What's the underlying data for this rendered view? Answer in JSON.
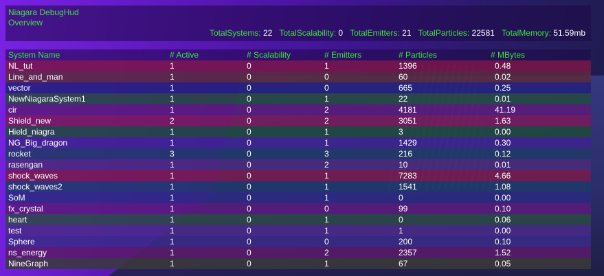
{
  "hud": {
    "title": "Niagara DebugHud",
    "subtitle": "Overview",
    "stats": [
      {
        "label": "TotalSystems:",
        "value": "22"
      },
      {
        "label": "TotalScalability:",
        "value": "0"
      },
      {
        "label": "TotalEmitters:",
        "value": "21"
      },
      {
        "label": "TotalParticles:",
        "value": "22581"
      },
      {
        "label": "TotalMemory:",
        "value": "51.59mb"
      }
    ]
  },
  "table": {
    "columns": [
      "System Name",
      "# Active",
      "# Scalability",
      "# Emitters",
      "# Particles",
      "# MBytes"
    ],
    "rows": [
      {
        "name": "NL_tut",
        "active": "1",
        "scal": "0",
        "emit": "1",
        "part": "1396",
        "mb": "0.48",
        "color": "#7a1546"
      },
      {
        "name": "Line_and_man",
        "active": "1",
        "scal": "0",
        "emit": "0",
        "part": "60",
        "mb": "0.02",
        "color": "#5a2a3a"
      },
      {
        "name": "vector",
        "active": "1",
        "scal": "0",
        "emit": "0",
        "part": "665",
        "mb": "0.25",
        "color": "#22207a"
      },
      {
        "name": "NewNiagaraSystem1",
        "active": "1",
        "scal": "0",
        "emit": "1",
        "part": "22",
        "mb": "0.01",
        "color": "#244a3e"
      },
      {
        "name": "cir",
        "active": "1",
        "scal": "0",
        "emit": "2",
        "part": "4181",
        "mb": "41.19",
        "color": "#5a1a7a"
      },
      {
        "name": "Shield_new",
        "active": "2",
        "scal": "0",
        "emit": "2",
        "part": "3051",
        "mb": "1.63",
        "color": "#7a1a5a"
      },
      {
        "name": "Hield_niagra",
        "active": "1",
        "scal": "0",
        "emit": "1",
        "part": "3",
        "mb": "0.00",
        "color": "#1e4a3a"
      },
      {
        "name": "NG_Big_dragon",
        "active": "1",
        "scal": "0",
        "emit": "1",
        "part": "1429",
        "mb": "0.30",
        "color": "#3e2290"
      },
      {
        "name": "rocket",
        "active": "3",
        "scal": "0",
        "emit": "3",
        "part": "216",
        "mb": "0.12",
        "color": "#1e3a66"
      },
      {
        "name": "rasengan",
        "active": "1",
        "scal": "0",
        "emit": "2",
        "part": "10",
        "mb": "0.01",
        "color": "#4a2a7a"
      },
      {
        "name": "shock_waves",
        "active": "1",
        "scal": "0",
        "emit": "1",
        "part": "7283",
        "mb": "4.66",
        "color": "#7a1a4a"
      },
      {
        "name": "shock_waves2",
        "active": "1",
        "scal": "0",
        "emit": "1",
        "part": "1541",
        "mb": "1.08",
        "color": "#1e3a6a"
      },
      {
        "name": "SoM",
        "active": "1",
        "scal": "0",
        "emit": "1",
        "part": "0",
        "mb": "0.00",
        "color": "#2a2a80"
      },
      {
        "name": "fx_crystal",
        "active": "1",
        "scal": "0",
        "emit": "0",
        "part": "99",
        "mb": "0.10",
        "color": "#5a1a7a"
      },
      {
        "name": "heart",
        "active": "1",
        "scal": "0",
        "emit": "1",
        "part": "0",
        "mb": "0.06",
        "color": "#2a4a44"
      },
      {
        "name": "test",
        "active": "1",
        "scal": "0",
        "emit": "1",
        "part": "1",
        "mb": "0.00",
        "color": "#4a2a8a"
      },
      {
        "name": "Sphere",
        "active": "1",
        "scal": "0",
        "emit": "0",
        "part": "200",
        "mb": "0.10",
        "color": "#3a2a88"
      },
      {
        "name": "ns_energy",
        "active": "1",
        "scal": "0",
        "emit": "2",
        "part": "2357",
        "mb": "1.52",
        "color": "#5a1a6a"
      },
      {
        "name": "NineGraph",
        "active": "1",
        "scal": "0",
        "emit": "1",
        "part": "67",
        "mb": "0.05",
        "color": "#3a3a3a"
      }
    ]
  }
}
